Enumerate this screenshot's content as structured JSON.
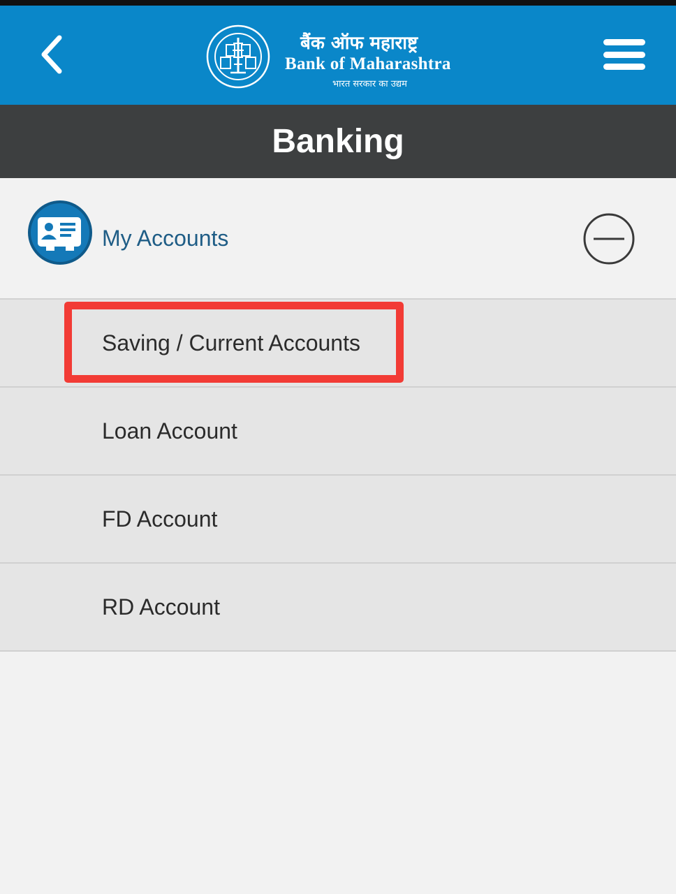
{
  "header": {
    "back_icon": "chevron-left-icon",
    "menu_icon": "hamburger-menu-icon",
    "logo": {
      "name_hindi": "बैंक ऑफ महाराष्ट्र",
      "name_english": "Bank of Maharashtra",
      "tagline_hindi": "भारत सरकार का उद्यम"
    }
  },
  "page": {
    "title": "Banking"
  },
  "accordion": {
    "label": "My Accounts",
    "icon": "account-card-icon",
    "toggle_icon": "minus-circle-icon",
    "items": [
      {
        "label": "Saving / Current Accounts"
      },
      {
        "label": "Loan Account"
      },
      {
        "label": "FD Account"
      },
      {
        "label": "RD Account"
      }
    ]
  },
  "colors": {
    "header_blue": "#0a87c9",
    "title_bar": "#3d3f40",
    "accordion_label": "#1f5d86",
    "highlight": "#f23b35",
    "sub_item_bg": "#e5e5e5",
    "page_bg": "#f2f2f2"
  }
}
